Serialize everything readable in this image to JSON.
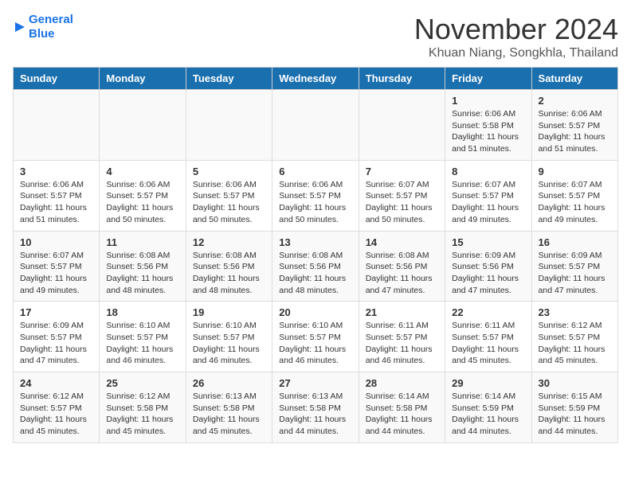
{
  "header": {
    "logo_line1": "General",
    "logo_line2": "Blue",
    "month": "November 2024",
    "location": "Khuan Niang, Songkhla, Thailand"
  },
  "days_of_week": [
    "Sunday",
    "Monday",
    "Tuesday",
    "Wednesday",
    "Thursday",
    "Friday",
    "Saturday"
  ],
  "weeks": [
    [
      {
        "day": "",
        "info": ""
      },
      {
        "day": "",
        "info": ""
      },
      {
        "day": "",
        "info": ""
      },
      {
        "day": "",
        "info": ""
      },
      {
        "day": "",
        "info": ""
      },
      {
        "day": "1",
        "info": "Sunrise: 6:06 AM\nSunset: 5:58 PM\nDaylight: 11 hours\nand 51 minutes."
      },
      {
        "day": "2",
        "info": "Sunrise: 6:06 AM\nSunset: 5:57 PM\nDaylight: 11 hours\nand 51 minutes."
      }
    ],
    [
      {
        "day": "3",
        "info": "Sunrise: 6:06 AM\nSunset: 5:57 PM\nDaylight: 11 hours\nand 51 minutes."
      },
      {
        "day": "4",
        "info": "Sunrise: 6:06 AM\nSunset: 5:57 PM\nDaylight: 11 hours\nand 50 minutes."
      },
      {
        "day": "5",
        "info": "Sunrise: 6:06 AM\nSunset: 5:57 PM\nDaylight: 11 hours\nand 50 minutes."
      },
      {
        "day": "6",
        "info": "Sunrise: 6:06 AM\nSunset: 5:57 PM\nDaylight: 11 hours\nand 50 minutes."
      },
      {
        "day": "7",
        "info": "Sunrise: 6:07 AM\nSunset: 5:57 PM\nDaylight: 11 hours\nand 50 minutes."
      },
      {
        "day": "8",
        "info": "Sunrise: 6:07 AM\nSunset: 5:57 PM\nDaylight: 11 hours\nand 49 minutes."
      },
      {
        "day": "9",
        "info": "Sunrise: 6:07 AM\nSunset: 5:57 PM\nDaylight: 11 hours\nand 49 minutes."
      }
    ],
    [
      {
        "day": "10",
        "info": "Sunrise: 6:07 AM\nSunset: 5:57 PM\nDaylight: 11 hours\nand 49 minutes."
      },
      {
        "day": "11",
        "info": "Sunrise: 6:08 AM\nSunset: 5:56 PM\nDaylight: 11 hours\nand 48 minutes."
      },
      {
        "day": "12",
        "info": "Sunrise: 6:08 AM\nSunset: 5:56 PM\nDaylight: 11 hours\nand 48 minutes."
      },
      {
        "day": "13",
        "info": "Sunrise: 6:08 AM\nSunset: 5:56 PM\nDaylight: 11 hours\nand 48 minutes."
      },
      {
        "day": "14",
        "info": "Sunrise: 6:08 AM\nSunset: 5:56 PM\nDaylight: 11 hours\nand 47 minutes."
      },
      {
        "day": "15",
        "info": "Sunrise: 6:09 AM\nSunset: 5:56 PM\nDaylight: 11 hours\nand 47 minutes."
      },
      {
        "day": "16",
        "info": "Sunrise: 6:09 AM\nSunset: 5:57 PM\nDaylight: 11 hours\nand 47 minutes."
      }
    ],
    [
      {
        "day": "17",
        "info": "Sunrise: 6:09 AM\nSunset: 5:57 PM\nDaylight: 11 hours\nand 47 minutes."
      },
      {
        "day": "18",
        "info": "Sunrise: 6:10 AM\nSunset: 5:57 PM\nDaylight: 11 hours\nand 46 minutes."
      },
      {
        "day": "19",
        "info": "Sunrise: 6:10 AM\nSunset: 5:57 PM\nDaylight: 11 hours\nand 46 minutes."
      },
      {
        "day": "20",
        "info": "Sunrise: 6:10 AM\nSunset: 5:57 PM\nDaylight: 11 hours\nand 46 minutes."
      },
      {
        "day": "21",
        "info": "Sunrise: 6:11 AM\nSunset: 5:57 PM\nDaylight: 11 hours\nand 46 minutes."
      },
      {
        "day": "22",
        "info": "Sunrise: 6:11 AM\nSunset: 5:57 PM\nDaylight: 11 hours\nand 45 minutes."
      },
      {
        "day": "23",
        "info": "Sunrise: 6:12 AM\nSunset: 5:57 PM\nDaylight: 11 hours\nand 45 minutes."
      }
    ],
    [
      {
        "day": "24",
        "info": "Sunrise: 6:12 AM\nSunset: 5:57 PM\nDaylight: 11 hours\nand 45 minutes."
      },
      {
        "day": "25",
        "info": "Sunrise: 6:12 AM\nSunset: 5:58 PM\nDaylight: 11 hours\nand 45 minutes."
      },
      {
        "day": "26",
        "info": "Sunrise: 6:13 AM\nSunset: 5:58 PM\nDaylight: 11 hours\nand 45 minutes."
      },
      {
        "day": "27",
        "info": "Sunrise: 6:13 AM\nSunset: 5:58 PM\nDaylight: 11 hours\nand 44 minutes."
      },
      {
        "day": "28",
        "info": "Sunrise: 6:14 AM\nSunset: 5:58 PM\nDaylight: 11 hours\nand 44 minutes."
      },
      {
        "day": "29",
        "info": "Sunrise: 6:14 AM\nSunset: 5:59 PM\nDaylight: 11 hours\nand 44 minutes."
      },
      {
        "day": "30",
        "info": "Sunrise: 6:15 AM\nSunset: 5:59 PM\nDaylight: 11 hours\nand 44 minutes."
      }
    ]
  ]
}
